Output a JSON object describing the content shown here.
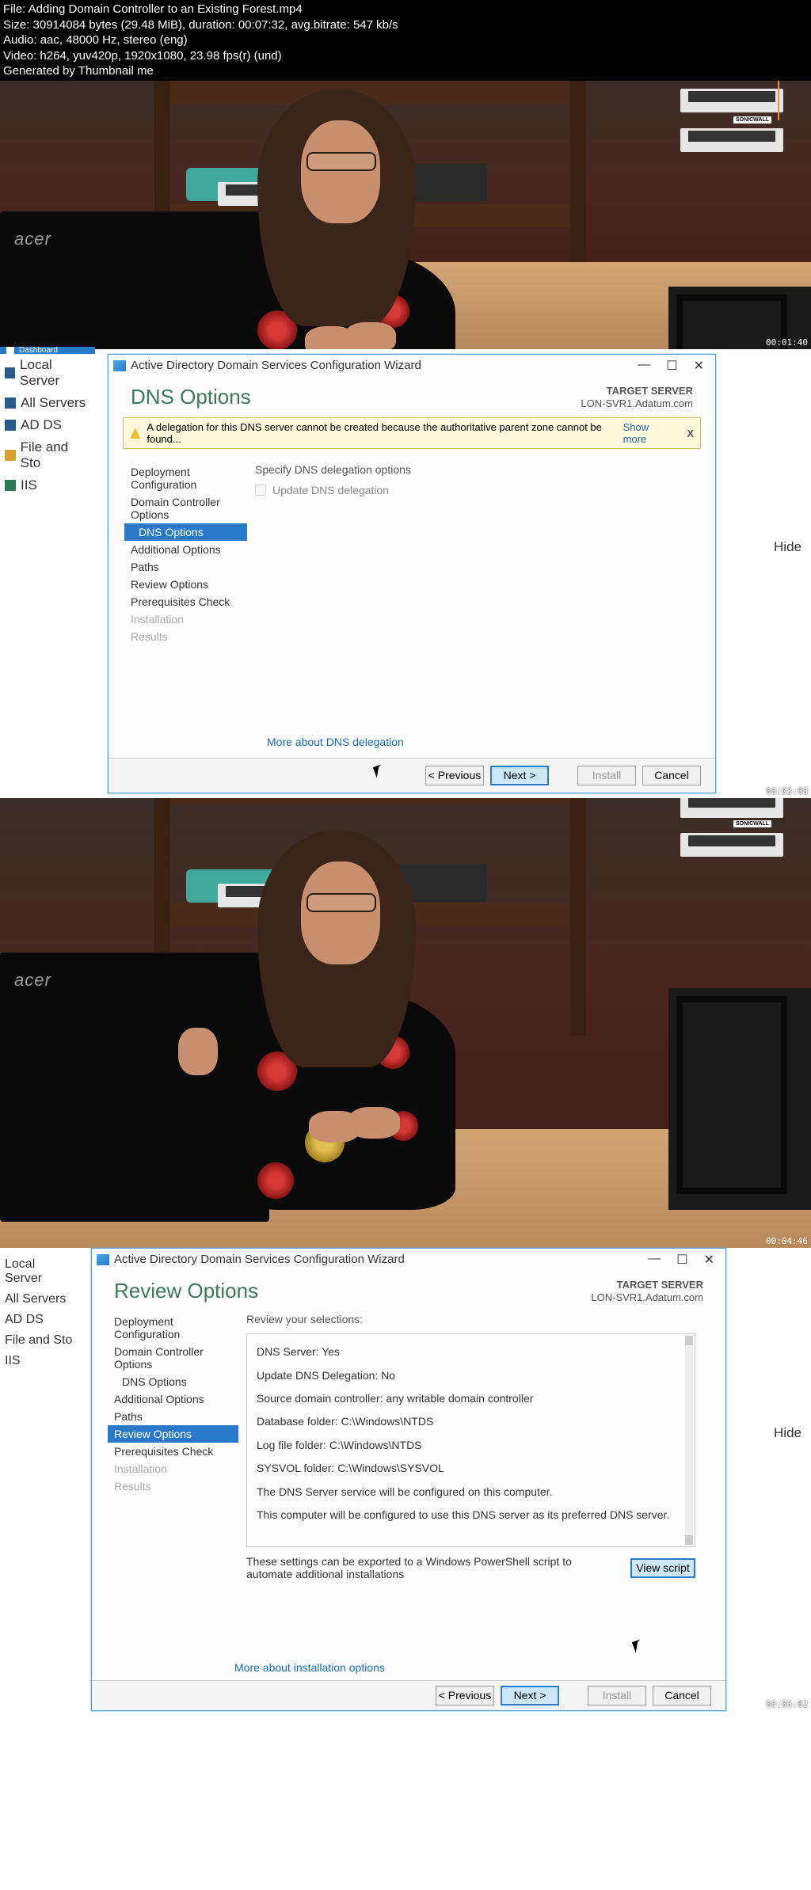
{
  "meta": {
    "file": "File: Adding Domain Controller to an Existing Forest.mp4",
    "size": "Size: 30914084 bytes (29.48 MiB), duration: 00:07:32, avg.bitrate: 547 kb/s",
    "audio": "Audio: aac, 48000 Hz, stereo (eng)",
    "video": "Video: h264, yuv420p, 1920x1080, 23.98 fps(r) (und)",
    "generated": "Generated by Thumbnail me"
  },
  "timestamps": {
    "t1": "00:01:40",
    "t2": "00:03:08",
    "t3": "00:04:46",
    "t4": "00:06:02"
  },
  "server_mgr": {
    "dashboard": "Dashboard",
    "local": "Local Server",
    "all": "All Servers",
    "adds": "AD DS",
    "file": "File and Sto",
    "iis": "IIS",
    "hide": "Hide"
  },
  "wizard": {
    "title_bar": "Active Directory Domain Services Configuration Wizard",
    "target_label": "TARGET SERVER",
    "target_value": "LON-SVR1.Adatum.com",
    "nav": {
      "deploy": "Deployment Configuration",
      "dc_opts": "Domain Controller Options",
      "dns_opts": "DNS Options",
      "add_opts": "Additional Options",
      "paths": "Paths",
      "review": "Review Options",
      "prereq": "Prerequisites Check",
      "install": "Installation",
      "results": "Results"
    },
    "dns": {
      "title": "DNS Options",
      "warning_text": "A delegation for this DNS server cannot be created because the authoritative parent zone cannot be found...",
      "show_more": "Show more",
      "close": "X",
      "specify": "Specify DNS delegation options",
      "update": "Update DNS delegation",
      "more": "More about DNS delegation"
    },
    "review": {
      "title": "Review Options",
      "header": "Review your selections:",
      "l1": "DNS Server: Yes",
      "l2": "Update DNS Delegation: No",
      "l3": "Source domain controller: any writable domain controller",
      "l4": "Database folder: C:\\Windows\\NTDS",
      "l5": "Log file folder: C:\\Windows\\NTDS",
      "l6": "SYSVOL folder: C:\\Windows\\SYSVOL",
      "l7": "The DNS Server service will be configured on this computer.",
      "l8": "This computer will be configured to use this DNS server as its preferred DNS server.",
      "export_note": "These settings can be exported to a Windows PowerShell script to automate additional installations",
      "view_script": "View script",
      "more": "More about installation options"
    },
    "buttons": {
      "prev": "< Previous",
      "next": "Next >",
      "install": "Install",
      "cancel": "Cancel"
    }
  },
  "monitor_brand": "acer",
  "rack_label": "SONICWALL"
}
